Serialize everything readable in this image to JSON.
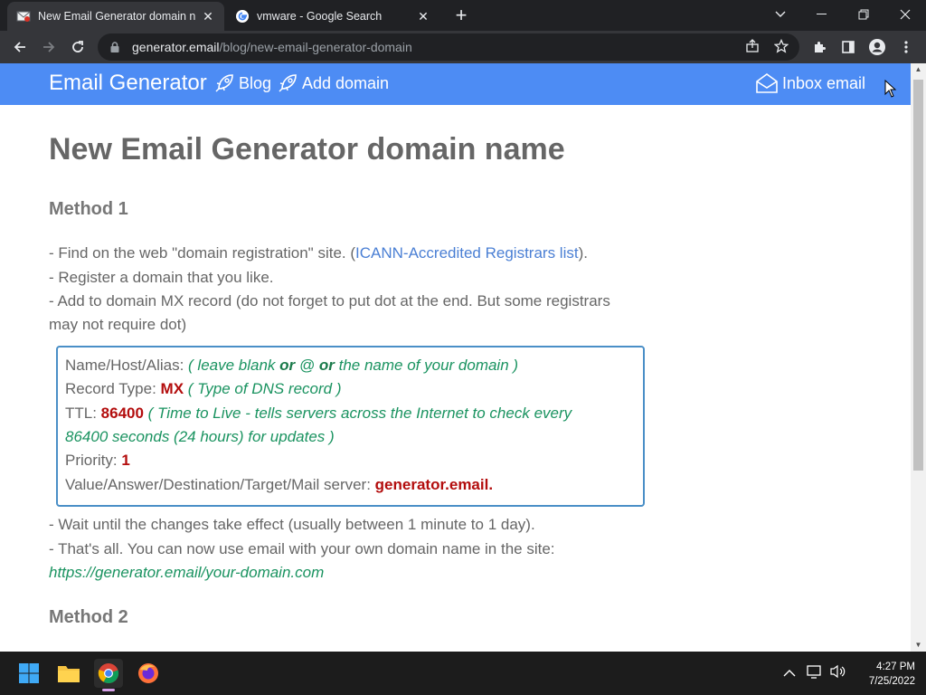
{
  "browser": {
    "tabs": [
      {
        "title": "New Email Generator domain name",
        "active": true
      },
      {
        "title": "vmware - Google Search",
        "active": false
      }
    ],
    "url_host": "generator.email",
    "url_path": "/blog/new-email-generator-domain"
  },
  "site": {
    "brand": "Email Generator",
    "nav": {
      "blog": "Blog",
      "add_domain": "Add domain",
      "inbox": "Inbox email"
    },
    "accent_color": "#4d8cf4"
  },
  "article": {
    "title": "New Email Generator domain name",
    "method1_heading": "Method 1",
    "step1_prefix": "- Find on the web \"domain registration\" site. (",
    "step1_link": "ICANN-Accredited Registrars list",
    "step1_suffix": ").",
    "step2": "- Register a domain that you like.",
    "step3_line1": "- Add to domain MX record (do not forget to put dot at the end. But some registrars",
    "step3_line2": "may not require dot)",
    "dns": {
      "name_label": "Name/Host/Alias: ",
      "name_hint_1": "( leave blank ",
      "name_hint_or1": "or",
      "name_hint_at": " @ ",
      "name_hint_or2": "or",
      "name_hint_2": " the name of your domain )",
      "type_label": "Record Type: ",
      "type_value": "MX",
      "type_hint": " ( Type of DNS record )",
      "ttl_label": "TTL: ",
      "ttl_value": "86400",
      "ttl_hint_1": " ( Time to Live - tells servers across the Internet to check every",
      "ttl_hint_2": "86400 seconds (24 hours) for updates )",
      "priority_label": "Priority: ",
      "priority_value": "1",
      "server_label": "Value/Answer/Destination/Target/Mail server: ",
      "server_value": "generator.email."
    },
    "step4": "- Wait until the changes take effect (usually between 1 minute to 1 day).",
    "step5": "- That's all. You can now use email with your own domain name in the site:",
    "example_url": "https://generator.email/your-domain.com",
    "method2_heading": "Method 2"
  },
  "taskbar": {
    "time": "4:27 PM",
    "date": "7/25/2022"
  }
}
